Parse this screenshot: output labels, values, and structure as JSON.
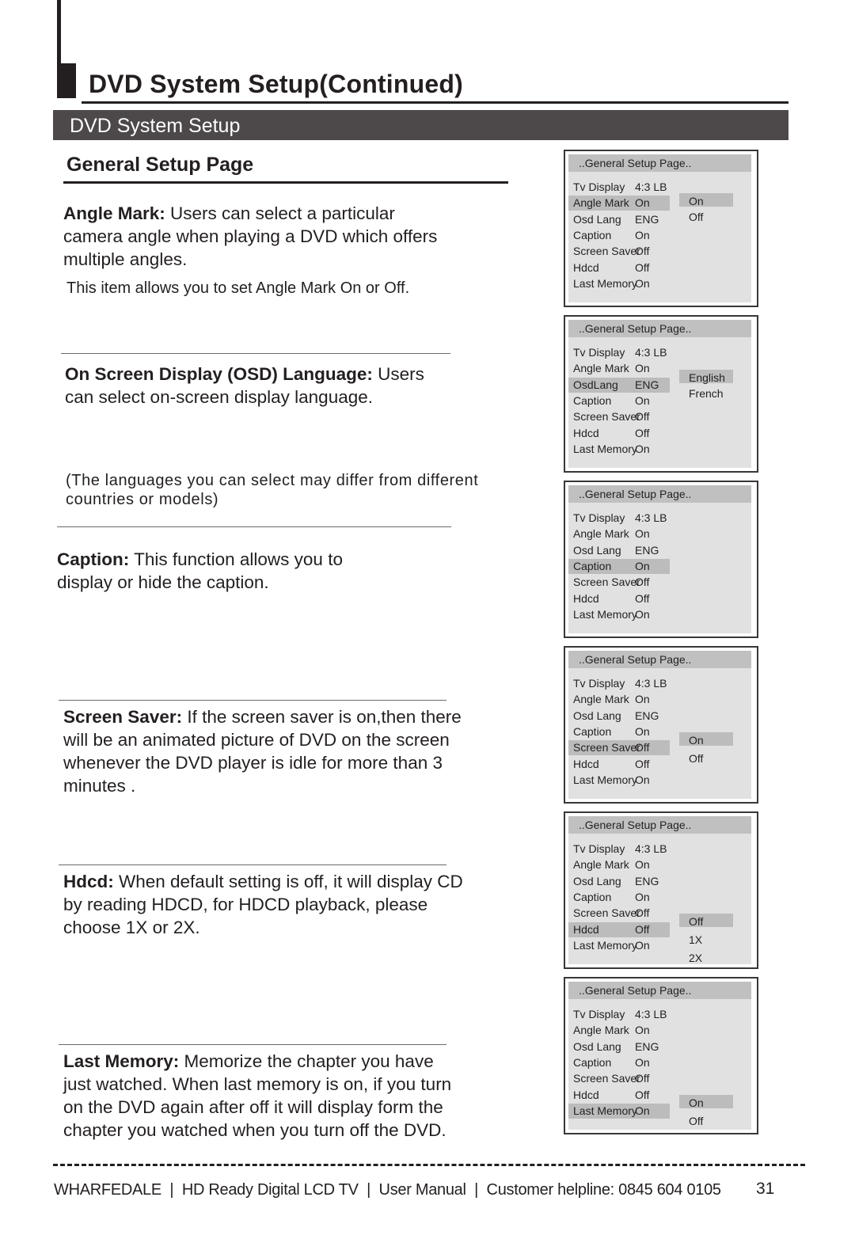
{
  "header": {
    "title": "DVD System Setup(Continued)",
    "section_bar": "DVD System Setup",
    "page_heading": "General Setup Page"
  },
  "sections": {
    "angle_mark": {
      "term": "Angle Mark:",
      "lines": [
        " Users can select a particular",
        "camera angle when playing  a DVD which offers",
        "multiple angles."
      ],
      "note": "This item allows you to set Angle Mark On or Off."
    },
    "osd_language": {
      "term": "On  Screen  Display (OSD) Language:",
      "lines": [
        "  Users",
        "can select on-screen display language."
      ],
      "note": "(The languages you can select may differ from different countries or models)"
    },
    "caption": {
      "term": "Caption:",
      "lines": [
        " This function allows you to",
        "display or hide the caption."
      ]
    },
    "screen_saver": {
      "term": "Screen Saver:",
      "lines": [
        " If the screen saver is on,then there",
        "will be an animated picture of DVD  on the screen",
        "whenever the DVD player is idle for  more than 3",
        "minutes ."
      ]
    },
    "hdcd": {
      "term": "Hdcd:",
      "lines": [
        " When default setting is off, it will display CD",
        "by reading HDCD, for HDCD playback, please",
        "choose 1X or 2X."
      ]
    },
    "last_memory": {
      "term": "Last Memory:",
      "lines": [
        " Memorize the chapter you have",
        "just watched. When last memory is on,  if you turn",
        "on the DVD again after off it will  display form the",
        "chapter you watched when you turn off the DVD."
      ]
    }
  },
  "osd_screens": [
    {
      "header": "..General Setup Page..",
      "rows": [
        {
          "label": "Tv Display",
          "value": "4:3 LB"
        },
        {
          "label": "Angle Mark",
          "value": "On"
        },
        {
          "label": "Osd Lang",
          "value": "ENG"
        },
        {
          "label": "Caption",
          "value": "On"
        },
        {
          "label": "Screen Saver",
          "value": "Off"
        },
        {
          "label": "Hdcd",
          "value": "Off"
        },
        {
          "label": "Last Memory",
          "value": "On"
        }
      ],
      "selected_row": 1,
      "options": [
        "On",
        "Off"
      ],
      "selected_option": 0
    },
    {
      "header": "..General Setup Page..",
      "rows": [
        {
          "label": "Tv Display",
          "value": "4:3 LB"
        },
        {
          "label": "Angle Mark",
          "value": "On"
        },
        {
          "label": "OsdLang",
          "value": "ENG"
        },
        {
          "label": "Caption",
          "value": "On"
        },
        {
          "label": "Screen Saver",
          "value": "Off"
        },
        {
          "label": "Hdcd",
          "value": "Off"
        },
        {
          "label": "Last Memory",
          "value": "On"
        }
      ],
      "selected_row": 2,
      "options": [
        "English",
        "French"
      ],
      "selected_option": 0
    },
    {
      "header": "..General Setup Page..",
      "rows": [
        {
          "label": "Tv Display",
          "value": "4:3 LB"
        },
        {
          "label": "Angle Mark",
          "value": "On"
        },
        {
          "label": "Osd Lang",
          "value": "ENG"
        },
        {
          "label": "Caption",
          "value": "On"
        },
        {
          "label": "Screen Saver",
          "value": "Off"
        },
        {
          "label": "Hdcd",
          "value": "Off"
        },
        {
          "label": "Last Memory",
          "value": "On"
        }
      ],
      "selected_row": 3,
      "options": [],
      "selected_option": null
    },
    {
      "header": "..General Setup Page..",
      "rows": [
        {
          "label": "Tv Display",
          "value": "4:3 LB"
        },
        {
          "label": "Angle Mark",
          "value": "On"
        },
        {
          "label": "Osd Lang",
          "value": "ENG"
        },
        {
          "label": "Caption",
          "value": "On"
        },
        {
          "label": "Screen Saver",
          "value": "Off"
        },
        {
          "label": "Hdcd",
          "value": "Off"
        },
        {
          "label": "Last Memory",
          "value": "On"
        }
      ],
      "selected_row": 4,
      "options": [
        "On",
        "Off"
      ],
      "selected_option": 0
    },
    {
      "header": "..General Setup Page..",
      "rows": [
        {
          "label": "Tv Display",
          "value": "4:3 LB"
        },
        {
          "label": "Angle Mark",
          "value": "On"
        },
        {
          "label": "Osd Lang",
          "value": "ENG"
        },
        {
          "label": "Caption",
          "value": "On"
        },
        {
          "label": "Screen Saver",
          "value": "Off"
        },
        {
          "label": "Hdcd",
          "value": "Off"
        },
        {
          "label": "Last Memory",
          "value": "On"
        }
      ],
      "selected_row": 5,
      "options": [
        "Off",
        "1X",
        "2X"
      ],
      "selected_option": 0
    },
    {
      "header": "..General Setup Page..",
      "rows": [
        {
          "label": "Tv Display",
          "value": "4:3 LB"
        },
        {
          "label": "Angle Mark",
          "value": "On"
        },
        {
          "label": "Osd Lang",
          "value": "ENG"
        },
        {
          "label": "Caption",
          "value": "On"
        },
        {
          "label": "Screen Saver",
          "value": "Off"
        },
        {
          "label": "Hdcd",
          "value": "Off"
        },
        {
          "label": "Last Memory",
          "value": "On"
        }
      ],
      "selected_row": 6,
      "options": [
        "On",
        "Off"
      ],
      "selected_option": 0
    }
  ],
  "footer": {
    "text": "WHARFEDALE  |  HD Ready Digital LCD TV  |  User Manual  |  Customer helpline: 0845 604 0105",
    "page_number": "31"
  }
}
